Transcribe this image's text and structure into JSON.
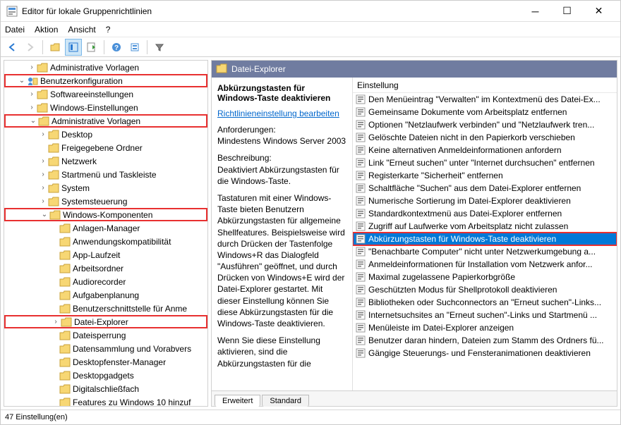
{
  "window": {
    "title": "Editor für lokale Gruppenrichtlinien"
  },
  "menu": {
    "file": "Datei",
    "action": "Aktion",
    "view": "Ansicht",
    "help": "?"
  },
  "status": "47 Einstellung(en)",
  "tree": [
    {
      "indent": 32,
      "exp": ">",
      "label": "Administrative Vorlagen"
    },
    {
      "indent": 16,
      "exp": "v",
      "label": "Benutzerkonfiguration",
      "red": true,
      "user": true
    },
    {
      "indent": 32,
      "exp": ">",
      "label": "Softwareeinstellungen"
    },
    {
      "indent": 32,
      "exp": ">",
      "label": "Windows-Einstellungen"
    },
    {
      "indent": 32,
      "exp": "v",
      "label": "Administrative Vorlagen",
      "red": true
    },
    {
      "indent": 48,
      "exp": ">",
      "label": "Desktop"
    },
    {
      "indent": 48,
      "exp": "",
      "label": "Freigegebene Ordner"
    },
    {
      "indent": 48,
      "exp": ">",
      "label": "Netzwerk"
    },
    {
      "indent": 48,
      "exp": ">",
      "label": "Startmenü und Taskleiste"
    },
    {
      "indent": 48,
      "exp": ">",
      "label": "System"
    },
    {
      "indent": 48,
      "exp": ">",
      "label": "Systemsteuerung"
    },
    {
      "indent": 48,
      "exp": "v",
      "label": "Windows-Komponenten",
      "red": true
    },
    {
      "indent": 64,
      "exp": "",
      "label": "Anlagen-Manager"
    },
    {
      "indent": 64,
      "exp": "",
      "label": "Anwendungskompatibilität"
    },
    {
      "indent": 64,
      "exp": "",
      "label": "App-Laufzeit"
    },
    {
      "indent": 64,
      "exp": "",
      "label": "Arbeitsordner"
    },
    {
      "indent": 64,
      "exp": "",
      "label": "Audiorecorder"
    },
    {
      "indent": 64,
      "exp": "",
      "label": "Aufgabenplanung"
    },
    {
      "indent": 64,
      "exp": "",
      "label": "Benutzerschnittstelle für Anme"
    },
    {
      "indent": 64,
      "exp": ">",
      "label": "Datei-Explorer",
      "red": true
    },
    {
      "indent": 64,
      "exp": "",
      "label": "Dateisperrung"
    },
    {
      "indent": 64,
      "exp": "",
      "label": "Datensammlung und Vorabvers"
    },
    {
      "indent": 64,
      "exp": "",
      "label": "Desktopfenster-Manager"
    },
    {
      "indent": 64,
      "exp": "",
      "label": "Desktopgadgets"
    },
    {
      "indent": 64,
      "exp": "",
      "label": "Digitalschließfach"
    },
    {
      "indent": 64,
      "exp": "",
      "label": "Features zu Windows 10 hinzuf"
    }
  ],
  "right": {
    "header": "Datei-Explorer",
    "detail_title": "Abkürzungstasten für Windows-Taste deaktivieren",
    "edit_link": "Richtlinieneinstellung bearbeiten",
    "req_label": "Anforderungen:",
    "req_val": "Mindestens Windows Server 2003",
    "desc_label": "Beschreibung:",
    "desc_val": "Deaktiviert Abkürzungstasten für die Windows-Taste.",
    "desc_long1": "Tastaturen mit einer Windows-Taste bieten Benutzern Abkürzungstasten für allgemeine Shellfeatures. Beispielsweise wird durch Drücken der Tastenfolge Windows+R das Dialogfeld \"Ausführen\" geöffnet, und durch Drücken von Windows+E wird der Datei-Explorer gestartet. Mit dieser Einstellung können Sie diese Abkürzungstasten für die Windows-Taste deaktivieren.",
    "desc_long2": "Wenn Sie diese Einstellung aktivieren, sind die Abkürzungstasten für die",
    "col_header": "Einstellung",
    "items": [
      "Den Menüeintrag \"Verwalten\" im Kontextmenü des Datei-Ex...",
      "Gemeinsame Dokumente vom Arbeitsplatz entfernen",
      "Optionen \"Netzlaufwerk verbinden\" und \"Netzlaufwerk tren...",
      "Gelöschte Dateien nicht in den Papierkorb verschieben",
      "Keine alternativen Anmeldeinformationen anfordern",
      "Link \"Erneut suchen\" unter \"Internet durchsuchen\" entfernen",
      "Registerkarte \"Sicherheit\" entfernen",
      "Schaltfläche \"Suchen\" aus dem Datei-Explorer entfernen",
      "Numerische Sortierung im Datei-Explorer deaktivieren",
      "Standardkontextmenü aus Datei-Explorer entfernen",
      "Zugriff auf Laufwerke vom Arbeitsplatz nicht zulassen",
      "Abkürzungstasten für Windows-Taste deaktivieren",
      "\"Benachbarte Computer\" nicht unter Netzwerkumgebung a...",
      "Anmeldeinformationen für Installation vom Netzwerk anfor...",
      "Maximal zugelassene Papierkorbgröße",
      "Geschützten Modus für Shellprotokoll deaktivieren",
      "Bibliotheken oder Suchconnectors an \"Erneut suchen\"-Links...",
      "Internetsuchsites an \"Erneut suchen\"-Links und Startmenü ...",
      "Menüleiste im Datei-Explorer anzeigen",
      "Benutzer daran hindern, Dateien zum Stamm des Ordners fü...",
      "Gängige Steuerungs- und Fensteranimationen deaktivieren"
    ],
    "selected": 11,
    "tabs": {
      "ext": "Erweitert",
      "std": "Standard"
    }
  }
}
